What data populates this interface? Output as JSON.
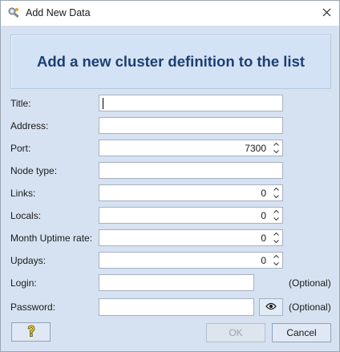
{
  "window": {
    "title": "Add New Data",
    "icon": "wrench-gear-icon",
    "close_icon": "close-icon"
  },
  "banner": {
    "heading": "Add a new cluster definition to the list"
  },
  "form": {
    "title": {
      "label": "Title:",
      "value": ""
    },
    "address": {
      "label": "Address:",
      "value": ""
    },
    "port": {
      "label": "Port:",
      "value": "7300"
    },
    "node_type": {
      "label": "Node type:",
      "value": ""
    },
    "links": {
      "label": "Links:",
      "value": "0"
    },
    "locals": {
      "label": "Locals:",
      "value": "0"
    },
    "month_uptime_rate": {
      "label": "Month Uptime rate:",
      "value": "0"
    },
    "updays": {
      "label": "Updays:",
      "value": "0"
    },
    "login": {
      "label": "Login:",
      "value": "",
      "hint": "(Optional)"
    },
    "password": {
      "label": "Password:",
      "value": "",
      "hint": "(Optional)",
      "toggle_icon": "eye-icon"
    }
  },
  "buttons": {
    "help_icon": "question-mark-icon",
    "ok": "OK",
    "cancel": "Cancel"
  },
  "colors": {
    "dialog_bg": "#d6e2f1",
    "banner_text": "#1d3f72",
    "help_icon": "#f2d21b"
  }
}
